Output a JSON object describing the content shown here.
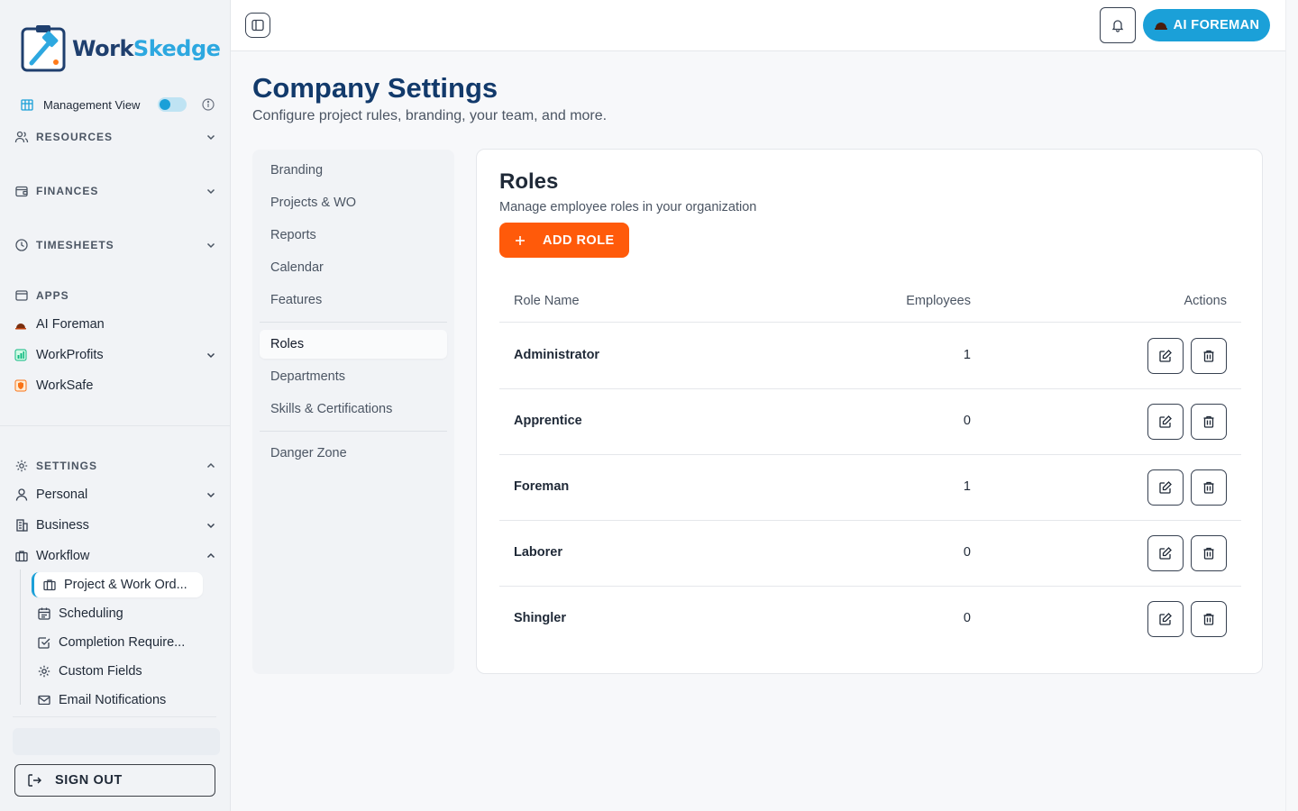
{
  "brand": {
    "name_part1": "Work",
    "name_part2": "Skedge"
  },
  "sidebar": {
    "management_view_label": "Management View",
    "management_view_on": true,
    "sections": {
      "resources": "RESOURCES",
      "finances": "FINANCES",
      "timesheets": "TIMESHEETS",
      "apps": "APPS",
      "settings": "SETTINGS"
    },
    "apps": [
      "AI Foreman",
      "WorkProfits",
      "WorkSafe"
    ],
    "settings_items": [
      "Personal",
      "Business",
      "Workflow"
    ],
    "workflow_items": [
      "Project & Work Ord...",
      "Scheduling",
      "Completion Require...",
      "Custom Fields",
      "Email Notifications"
    ],
    "sign_out": "SIGN OUT"
  },
  "topbar": {
    "ai_button": "AI FOREMAN"
  },
  "header": {
    "title": "Company Settings",
    "subtitle": "Configure project rules, branding, your team, and more."
  },
  "settings_nav": {
    "group1": [
      "Branding",
      "Projects & WO",
      "Reports",
      "Calendar",
      "Features"
    ],
    "group2": [
      "Roles",
      "Departments",
      "Skills & Certifications"
    ],
    "group3": [
      "Danger Zone"
    ],
    "active": "Roles"
  },
  "roles": {
    "title": "Roles",
    "subtitle": "Manage employee roles in your organization",
    "add_button": "ADD ROLE",
    "columns": [
      "Role Name",
      "Employees",
      "Actions"
    ],
    "rows": [
      {
        "name": "Administrator",
        "employees": "1"
      },
      {
        "name": "Apprentice",
        "employees": "0"
      },
      {
        "name": "Foreman",
        "employees": "1"
      },
      {
        "name": "Laborer",
        "employees": "0"
      },
      {
        "name": "Shingler",
        "employees": "0"
      }
    ]
  },
  "colors": {
    "accent": "#1ba0d8",
    "primary_action": "#ff5a0a",
    "title": "#123a6b"
  }
}
